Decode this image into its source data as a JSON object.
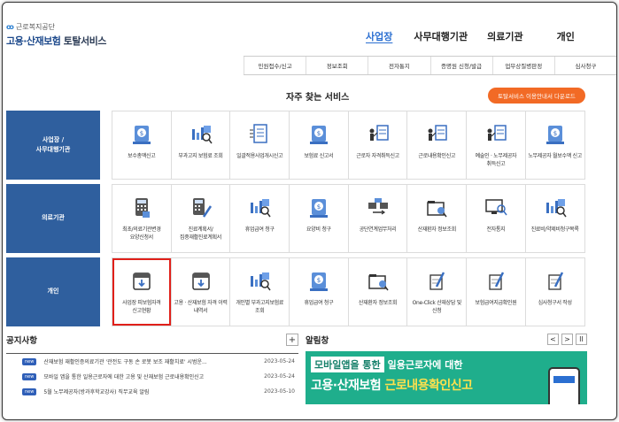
{
  "header": {
    "logo_org": "근로복지공단",
    "logo_main": "고용·산재보험",
    "logo_service": "토탈서비스",
    "nav": [
      "사업장",
      "사무대행기관",
      "의료기관",
      "개인"
    ]
  },
  "subnav": [
    "민원접수/신고",
    "정보조회",
    "전자통지",
    "증명원 신청/발급",
    "업무상질병판정",
    "심사청구"
  ],
  "favorites": {
    "title": "자주 찾는 서비스",
    "guide_button": "토탈서비스 이용안내서 다운로드"
  },
  "rows": [
    {
      "label": "사업장 /\n사무대행기관",
      "items": [
        {
          "label": "보수총액신고",
          "icon": "coin-document-icon"
        },
        {
          "label": "부과고지 보험료 조회",
          "icon": "chart-search-icon"
        },
        {
          "label": "일괄적용사업개시신고",
          "icon": "document-list-icon"
        },
        {
          "label": "보험료 신고서",
          "icon": "coin-document-icon"
        },
        {
          "label": "근로자 자격취득신고",
          "icon": "people-document-icon"
        },
        {
          "label": "근로내용확인신고",
          "icon": "people-document-icon"
        },
        {
          "label": "예술인 · 노무제공자 취득신고",
          "icon": "people-document-icon"
        },
        {
          "label": "노무제공자 월보수액 신고",
          "icon": "coin-document-icon"
        }
      ]
    },
    {
      "label": "의료기관",
      "items": [
        {
          "label": "최초/의료기관변경 요양신청서",
          "icon": "calculator-icon"
        },
        {
          "label": "진료계획서/집중재활진료계획서",
          "icon": "calculator-pen-icon"
        },
        {
          "label": "휴업급여 청구",
          "icon": "chart-search-icon"
        },
        {
          "label": "요양비 청구",
          "icon": "coin-document-icon"
        },
        {
          "label": "공단연계업무처리",
          "icon": "computer-link-icon"
        },
        {
          "label": "산재환자 정보조회",
          "icon": "folder-search-icon"
        },
        {
          "label": "전자통지",
          "icon": "monitor-search-icon"
        },
        {
          "label": "진료비/약제비청구목록",
          "icon": "chart-search-icon"
        }
      ]
    },
    {
      "label": "개인",
      "items": [
        {
          "label": "사업장 피보험자격 신고현황",
          "icon": "folder-download-icon",
          "highlight": true
        },
        {
          "label": "고용 · 산재보험 자격 이력 내역서",
          "icon": "folder-download-icon"
        },
        {
          "label": "개인별 부과고지보험료 조회",
          "icon": "chart-search-icon"
        },
        {
          "label": "휴업급여 청구",
          "icon": "coin-document-icon"
        },
        {
          "label": "산재환자 정보조회",
          "icon": "folder-search-icon"
        },
        {
          "label": "One-Click 산재상담 및 신청",
          "icon": "pen-document-icon"
        },
        {
          "label": "보험급여지급확인원",
          "icon": "pen-document-icon"
        },
        {
          "label": "심사청구서 작성",
          "icon": "pen-document-icon"
        }
      ]
    }
  ],
  "notice": {
    "title": "공지사항",
    "plus": "+",
    "items": [
      {
        "badge": "new",
        "text": "산재보험 재활인증의료기관 '관전도 구동 손 로봇 보조 재활치료' 시범운...",
        "date": "2023-05-24"
      },
      {
        "badge": "new",
        "text": "모바일 앱을 통한 일용근로자에 대한 고용 및 산재보험 근로내용확인신고",
        "date": "2023-05-24"
      },
      {
        "badge": "new",
        "text": "5월 노무제공자(방과후학교강사) 직무교육 알림",
        "date": "2023-05-10"
      }
    ]
  },
  "alert": {
    "title": "알림창",
    "prev": "<",
    "next": ">",
    "pause": "II",
    "banner_box": "모바일앱을 통한",
    "banner_l1": "일용근로자에 대한",
    "banner_l2a": "고용·산재보험",
    "banner_l2b": "근로내용확인신고"
  }
}
